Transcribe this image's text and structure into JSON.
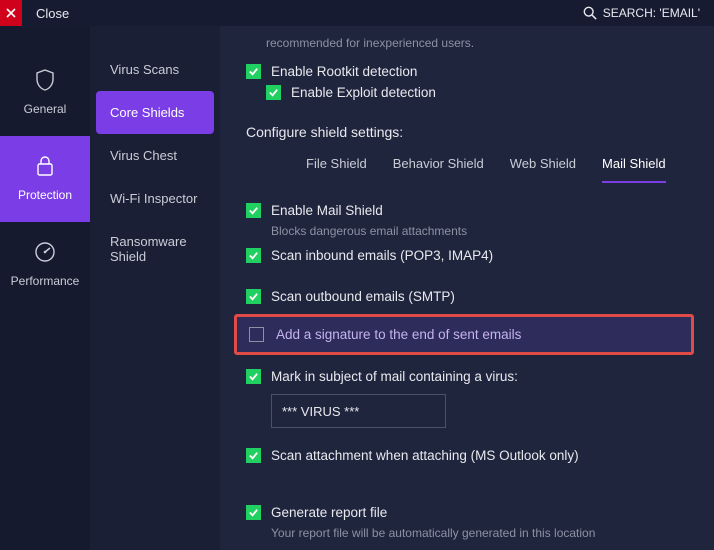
{
  "topbar": {
    "close_label": "Close",
    "search_label": "SEARCH: 'EMAIL'"
  },
  "rail": {
    "general": "General",
    "protection": "Protection",
    "performance": "Performance"
  },
  "menu": {
    "virus_scans": "Virus Scans",
    "core_shields": "Core Shields",
    "virus_chest": "Virus Chest",
    "wifi_inspector": "Wi-Fi Inspector",
    "ransomware_shield": "Ransomware Shield"
  },
  "content": {
    "hint": "recommended for inexperienced users.",
    "rootkit": "Enable Rootkit detection",
    "exploit": "Enable Exploit detection",
    "section_heading": "Configure shield settings:",
    "tab_file": "File Shield",
    "tab_behavior": "Behavior Shield",
    "tab_web": "Web Shield",
    "tab_mail": "Mail Shield",
    "mailshield_enable": "Enable Mail Shield",
    "mailshield_sub": "Blocks dangerous email attachments",
    "scan_inbound": "Scan inbound emails (POP3, IMAP4)",
    "scan_outbound": "Scan outbound emails (SMTP)",
    "add_signature": "Add a signature to the end of sent emails",
    "mark_subject": "Mark in subject of mail containing a virus:",
    "virus_tag": "*** VIRUS ***",
    "scan_attachment": "Scan attachment when attaching (MS Outlook only)",
    "generate_report": "Generate report file",
    "report_sub": "Your report file will be automatically generated in this location"
  }
}
